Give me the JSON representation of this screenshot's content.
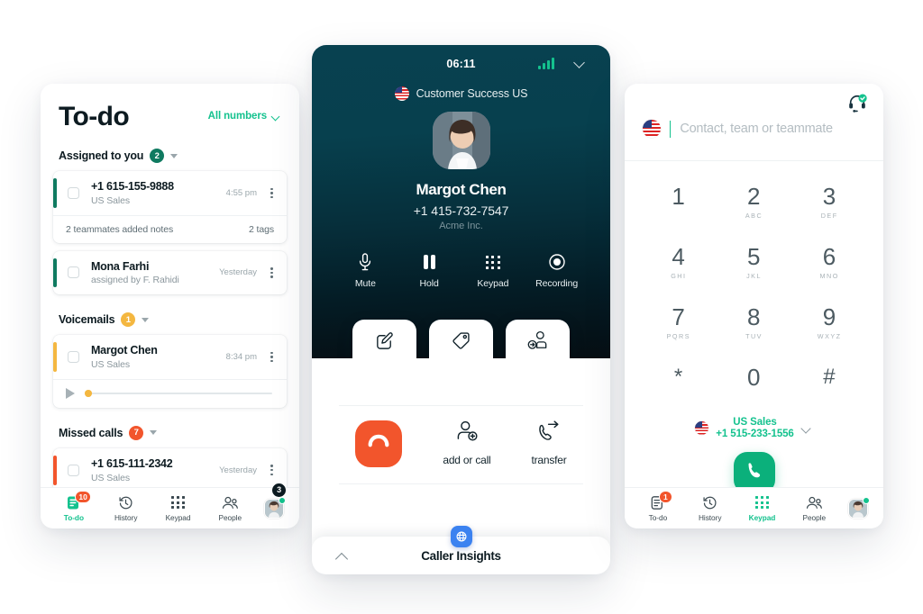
{
  "left": {
    "title": "To-do",
    "filter_label": "All numbers",
    "sections": [
      {
        "label": "Assigned to you",
        "count": "2",
        "badge_color": "#0f7a60",
        "items": [
          {
            "name": "+1 615-155-9888",
            "sub": "US Sales",
            "time": "4:55 pm",
            "stripe": "green",
            "note_left": "2 teammates added notes",
            "note_right": "2 tags"
          },
          {
            "name": "Mona Farhi",
            "sub": "assigned by F. Rahidi",
            "time": "Yesterday",
            "stripe": "green"
          }
        ]
      },
      {
        "label": "Voicemails",
        "count": "1",
        "badge_color": "#f4b740",
        "items": [
          {
            "name": "Margot Chen",
            "sub": "US Sales",
            "time": "8:34 pm",
            "stripe": "amber",
            "has_player": true
          }
        ]
      },
      {
        "label": "Missed calls",
        "count": "7",
        "badge_color": "#f2552c",
        "items": [
          {
            "name": "+1 615-111-2342",
            "sub": "US Sales",
            "time": "Yesterday",
            "stripe": "red"
          }
        ]
      }
    ],
    "nav": {
      "items": [
        {
          "label": "To-do",
          "icon": "todo-list-icon",
          "badge": "10",
          "active": true
        },
        {
          "label": "History",
          "icon": "clock-history-icon",
          "badge": "",
          "active": false
        },
        {
          "label": "Keypad",
          "icon": "keypad-dots-icon",
          "badge": "",
          "active": false
        },
        {
          "label": "People",
          "icon": "people-icon",
          "badge": "",
          "active": false
        }
      ],
      "avatar_badge": "3"
    }
  },
  "center": {
    "status": {
      "time": "06:11",
      "signal_icon": "signal-bars-icon",
      "collapse_icon": "chevron-down-icon"
    },
    "team": {
      "label": "Customer Success US",
      "flag": "us-flag-icon"
    },
    "caller": {
      "name": "Margot Chen",
      "phone": "+1 415-732-7547",
      "org": "Acme Inc."
    },
    "actions": [
      {
        "label": "Mute",
        "icon": "microphone-icon"
      },
      {
        "label": "Hold",
        "icon": "pause-icon"
      },
      {
        "label": "Keypad",
        "icon": "keypad-dots-icon"
      },
      {
        "label": "Recording",
        "icon": "record-circle-icon"
      }
    ],
    "cards": [
      {
        "label": "Notes",
        "icon": "note-pencil-icon"
      },
      {
        "label": "Tags",
        "icon": "tag-icon"
      },
      {
        "label": "Assign",
        "icon": "assign-person-icon"
      }
    ],
    "bottom": {
      "hangup_icon": "hangup-phone-icon",
      "items": [
        {
          "label": "add or call",
          "icon": "add-person-icon"
        },
        {
          "label": "transfer",
          "icon": "transfer-call-icon"
        }
      ]
    },
    "insights": {
      "title": "Caller Insights",
      "expand_icon": "chevron-up-icon",
      "badge_icon": "insights-globe-icon",
      "badge_color": "#3b82f0"
    }
  },
  "right": {
    "headset_icon": "headset-available-icon",
    "search": {
      "placeholder": "Contact, team or teammate",
      "value": "",
      "flag": "us-flag-icon"
    },
    "keypad": [
      [
        {
          "num": "1",
          "letters": ""
        },
        {
          "num": "2",
          "letters": "ABC"
        },
        {
          "num": "3",
          "letters": "DEF"
        }
      ],
      [
        {
          "num": "4",
          "letters": "GHI"
        },
        {
          "num": "5",
          "letters": "JKL"
        },
        {
          "num": "6",
          "letters": "MNO"
        }
      ],
      [
        {
          "num": "7",
          "letters": "PQRS"
        },
        {
          "num": "8",
          "letters": "TUV"
        },
        {
          "num": "9",
          "letters": "WXYZ"
        }
      ],
      [
        {
          "num": "*",
          "letters": ""
        },
        {
          "num": "0",
          "letters": ""
        },
        {
          "num": "#",
          "letters": ""
        }
      ]
    ],
    "from": {
      "line1": "US Sales",
      "line2": "+1 515-233-1556",
      "flag": "us-flag-icon"
    },
    "call_button": {
      "icon": "phone-call-icon",
      "color": "#0bb07b"
    },
    "nav": {
      "items": [
        {
          "label": "To-do",
          "icon": "todo-list-icon",
          "badge": "1",
          "active": false
        },
        {
          "label": "History",
          "icon": "clock-history-icon",
          "badge": "",
          "active": false
        },
        {
          "label": "Keypad",
          "icon": "keypad-dots-icon",
          "badge": "",
          "active": true
        },
        {
          "label": "People",
          "icon": "people-icon",
          "badge": "",
          "active": false
        }
      ]
    }
  },
  "theme": {
    "accent_green": "#14c28e",
    "dark_teal": "#063d4b",
    "red": "#f2552c",
    "amber": "#f4b740",
    "blue": "#3b82f0"
  }
}
